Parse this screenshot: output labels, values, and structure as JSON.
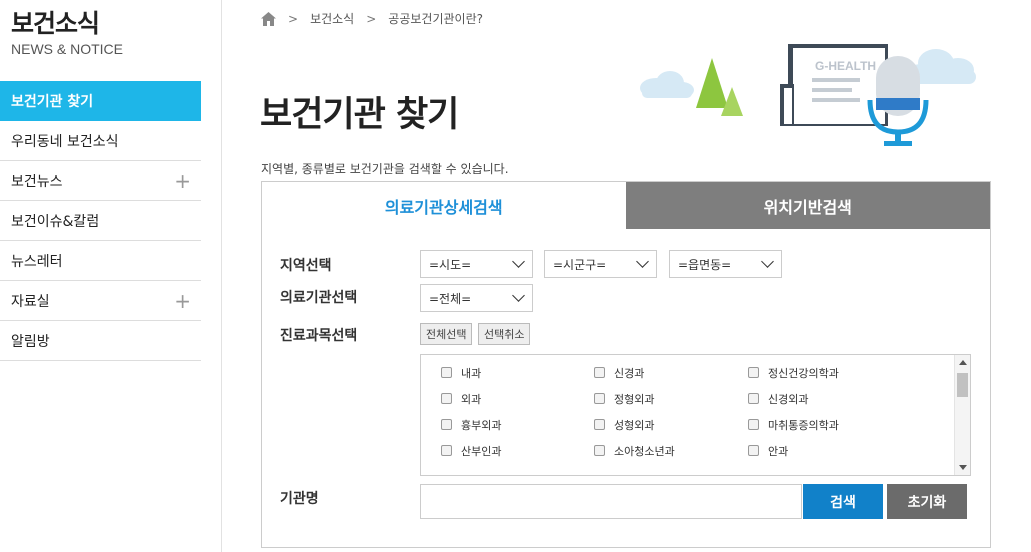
{
  "sidebar": {
    "title": "보건소식",
    "subtitle": "NEWS & NOTICE",
    "items": [
      {
        "label": "보건기관 찾기",
        "active": true,
        "expand": ""
      },
      {
        "label": "우리동네 보건소식",
        "active": false,
        "expand": ""
      },
      {
        "label": "보건뉴스",
        "active": false,
        "expand": "+"
      },
      {
        "label": "보건이슈&칼럼",
        "active": false,
        "expand": ""
      },
      {
        "label": "뉴스레터",
        "active": false,
        "expand": ""
      },
      {
        "label": "자료실",
        "active": false,
        "expand": "+"
      },
      {
        "label": "알림방",
        "active": false,
        "expand": ""
      }
    ]
  },
  "breadcrumb": [
    "보건소식",
    "공공보건기관이란?"
  ],
  "page": {
    "title": "보건기관 찾기",
    "description": "지역별, 종류별로 보건기관을 검색할 수 있습니다."
  },
  "illustration": {
    "label": "G-HEALTH"
  },
  "tabs": [
    {
      "label": "의료기관상세검색",
      "active": true
    },
    {
      "label": "위치기반검색",
      "active": false
    }
  ],
  "form": {
    "region_label": "지역선택",
    "sido_value": "=시도=",
    "sigungu_value": "=시군구=",
    "eupmyeondong_value": "=읍면동=",
    "institution_label": "의료기관선택",
    "institution_value": "=전체=",
    "dept_label": "진료과목선택",
    "select_all": "전체선택",
    "deselect_all": "선택취소",
    "departments": [
      "내과",
      "신경과",
      "정신건강의학과",
      "외과",
      "정형외과",
      "신경외과",
      "흉부외과",
      "성형외과",
      "마취통증의학과",
      "산부인과",
      "소아청소년과",
      "안과"
    ],
    "name_label": "기관명",
    "name_value": "",
    "search_button": "검색",
    "reset_button": "초기화"
  },
  "colors": {
    "accent": "#1eb6e8",
    "tab_active_text": "#1e90d8",
    "tab_inactive_bg": "#7e7e7e",
    "search_btn": "#1181c9",
    "reset_btn": "#6b6b6b"
  }
}
